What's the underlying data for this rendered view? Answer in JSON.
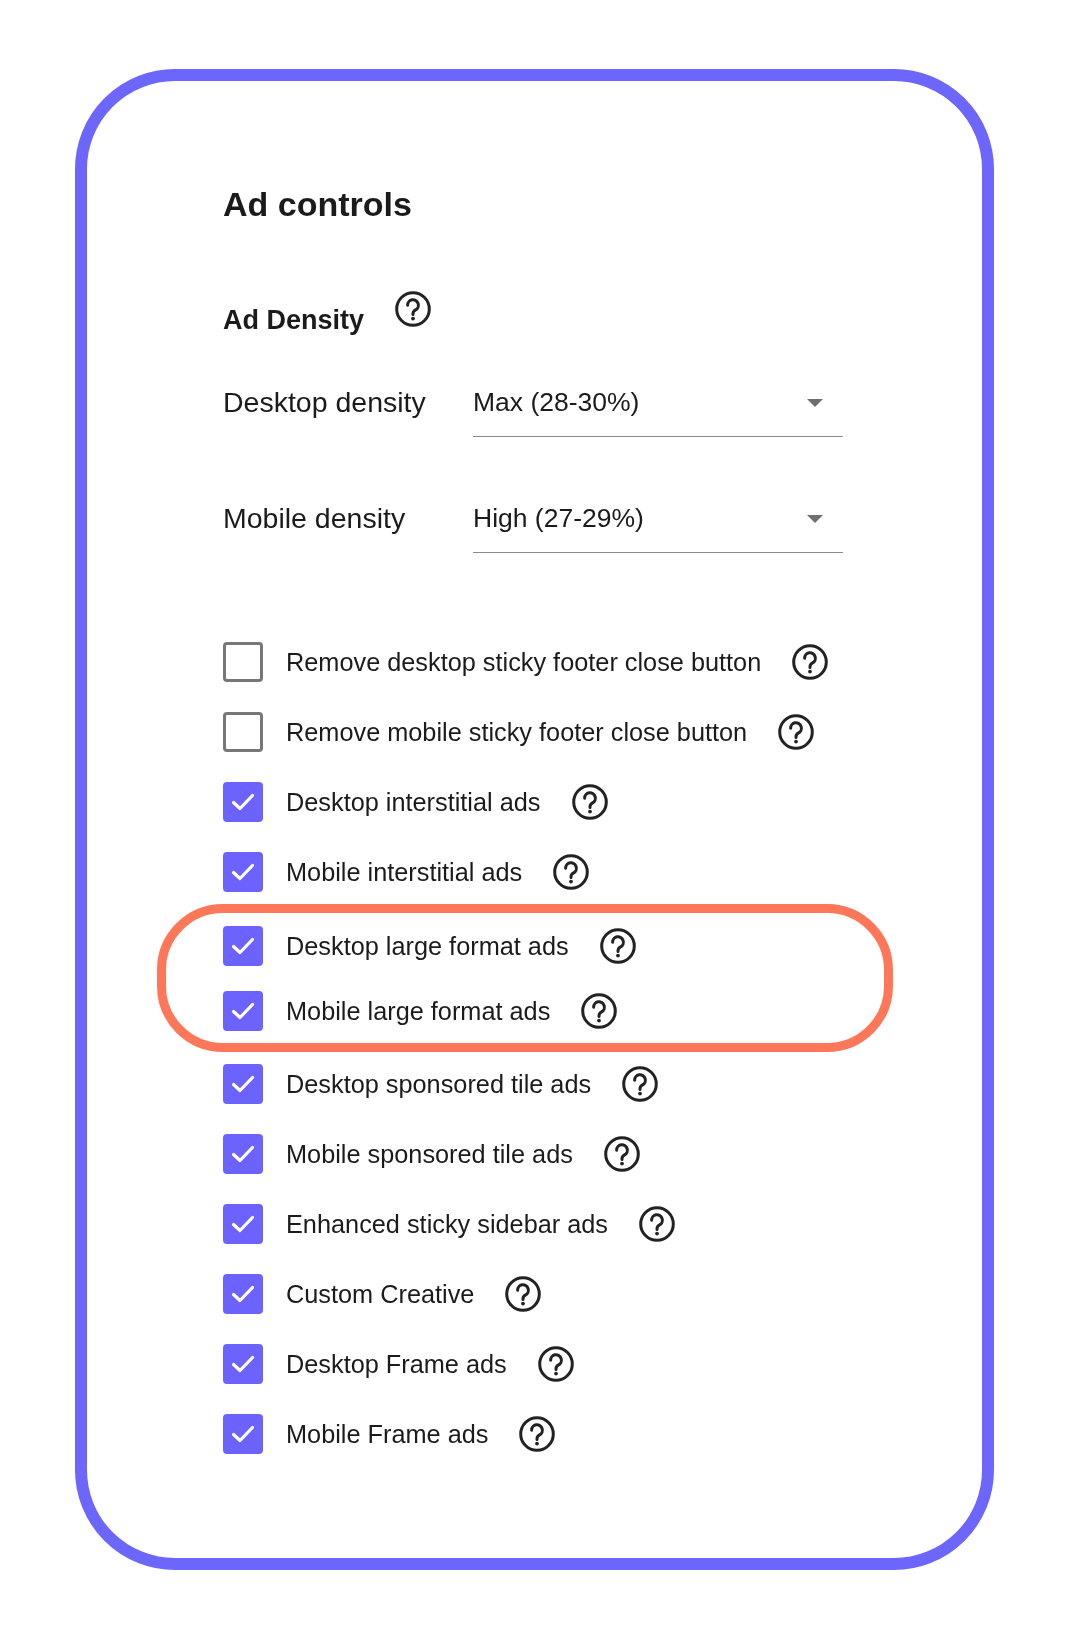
{
  "title": "Ad controls",
  "density": {
    "heading": "Ad Density",
    "selects": [
      {
        "label": "Desktop density",
        "value": "Max (28-30%)"
      },
      {
        "label": "Mobile density",
        "value": "High (27-29%)"
      }
    ]
  },
  "options": [
    {
      "label": "Remove desktop sticky footer close button",
      "checked": false,
      "highlighted": false
    },
    {
      "label": "Remove mobile sticky footer close button",
      "checked": false,
      "highlighted": false
    },
    {
      "label": "Desktop interstitial ads",
      "checked": true,
      "highlighted": false
    },
    {
      "label": "Mobile interstitial ads",
      "checked": true,
      "highlighted": false
    },
    {
      "label": "Desktop large format ads",
      "checked": true,
      "highlighted": true
    },
    {
      "label": "Mobile large format ads",
      "checked": true,
      "highlighted": true
    },
    {
      "label": "Desktop sponsored tile ads",
      "checked": true,
      "highlighted": false
    },
    {
      "label": "Mobile sponsored tile ads",
      "checked": true,
      "highlighted": false
    },
    {
      "label": "Enhanced sticky sidebar ads",
      "checked": true,
      "highlighted": false
    },
    {
      "label": "Custom Creative",
      "checked": true,
      "highlighted": false
    },
    {
      "label": "Desktop Frame ads",
      "checked": true,
      "highlighted": false
    },
    {
      "label": "Mobile Frame ads",
      "checked": true,
      "highlighted": false
    }
  ]
}
